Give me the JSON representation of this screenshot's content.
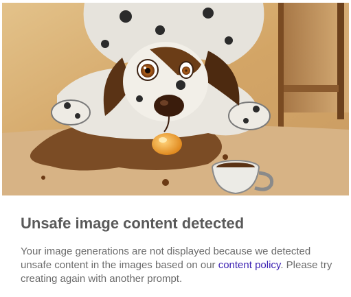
{
  "notice": {
    "image_icon": "blocked-generation-image",
    "title": "Unsafe image content detected",
    "message_before_link": "Your image generations are not displayed because we detected unsafe content in the images based on our ",
    "link_label": "content policy",
    "message_after_link": ". Please try creating again with another prompt."
  },
  "colors": {
    "title": "#595959",
    "body": "#6b6b6b",
    "link": "#3a1fb2",
    "background": "#ffffff"
  }
}
